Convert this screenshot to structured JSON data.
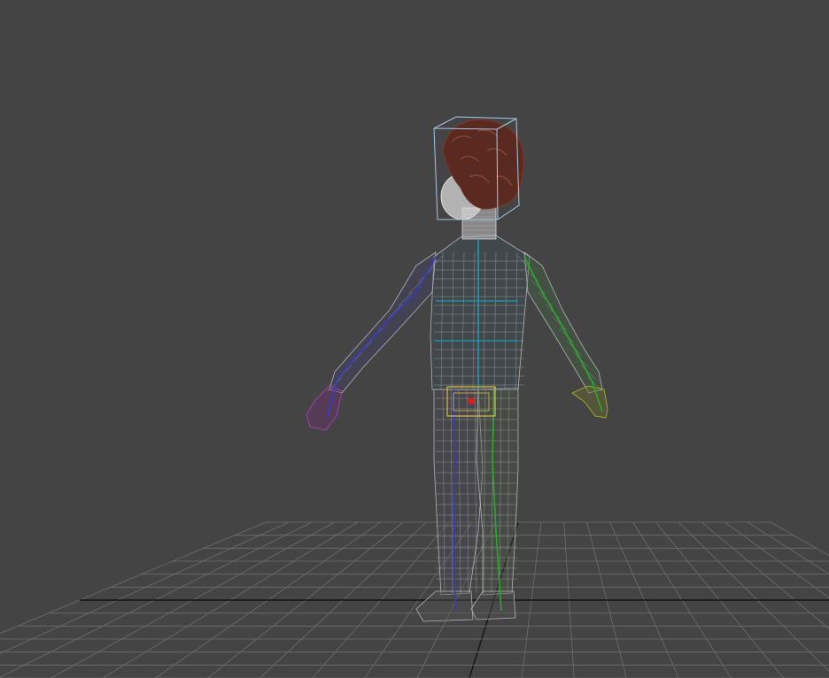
{
  "viewport": {
    "mode": "wireframe",
    "colors": {
      "background": "#444444",
      "grid": "#6e6e6e",
      "grid_axis": "#111111",
      "mesh": "#b4b4b4",
      "hair": "#5a2a20",
      "bounding_box": "#a8c8e8",
      "selection_box": "#d8c040",
      "rig_left": "#3a3ac8",
      "rig_right": "#2ea82e",
      "rig_spine": "#1e9ab8",
      "rig_hand_left": "#b040c0",
      "rig_hand_right": "#a8c020"
    }
  }
}
